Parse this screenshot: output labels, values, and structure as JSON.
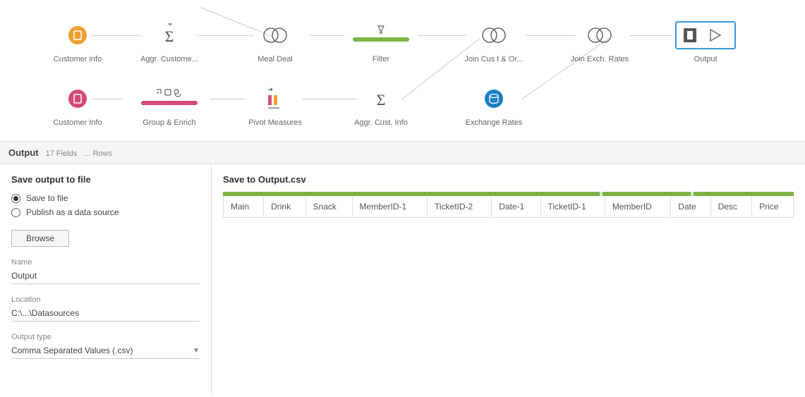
{
  "flow": {
    "row1": [
      {
        "label": "Customer info",
        "type": "datasource",
        "color": "#f0a030"
      },
      {
        "label": "Aggr. Custome...",
        "type": "aggregate",
        "pre_icon": "filter"
      },
      {
        "label": "Meal Deal",
        "type": "join"
      },
      {
        "label": "Filter",
        "type": "filter-step",
        "color": "#7cb342"
      },
      {
        "label": "Join Cus t & Or...",
        "type": "join"
      },
      {
        "label": "Join Exch. Rates",
        "type": "join"
      },
      {
        "label": "Output",
        "type": "output",
        "selected": true
      }
    ],
    "row2": [
      {
        "label": "Customer Info",
        "type": "datasource",
        "color": "#d14a7a"
      },
      {
        "label": "Group & Enrich",
        "type": "group-enrich",
        "color": "#d14a7a"
      },
      {
        "label": "Pivot Measures",
        "type": "pivot"
      },
      {
        "label": "Aggr. Cust. Info",
        "type": "aggregate"
      },
      {
        "label": "Exchange Rates",
        "type": "datasource",
        "color": "#1e7fc4"
      }
    ]
  },
  "summary": {
    "title": "Output",
    "fields": "17 Fields",
    "rows": "... Rows"
  },
  "side": {
    "title": "Save output to file",
    "radio_save": "Save to file",
    "radio_publish": "Publish as a data source",
    "browse": "Browse",
    "name_label": "Name",
    "name_value": "Output",
    "location_label": "Location",
    "location_value": "C:\\...\\Datasources",
    "type_label": "Output type",
    "type_value": "Comma Separated Values (.csv)"
  },
  "preview": {
    "title": "Save to Output.csv",
    "columns": [
      "Main",
      "Drink",
      "Snack",
      "MemberID-1",
      "TicketID-2",
      "Date-1",
      "TicketID-1",
      "MemberID",
      "Date",
      "Desc",
      "Price"
    ]
  }
}
